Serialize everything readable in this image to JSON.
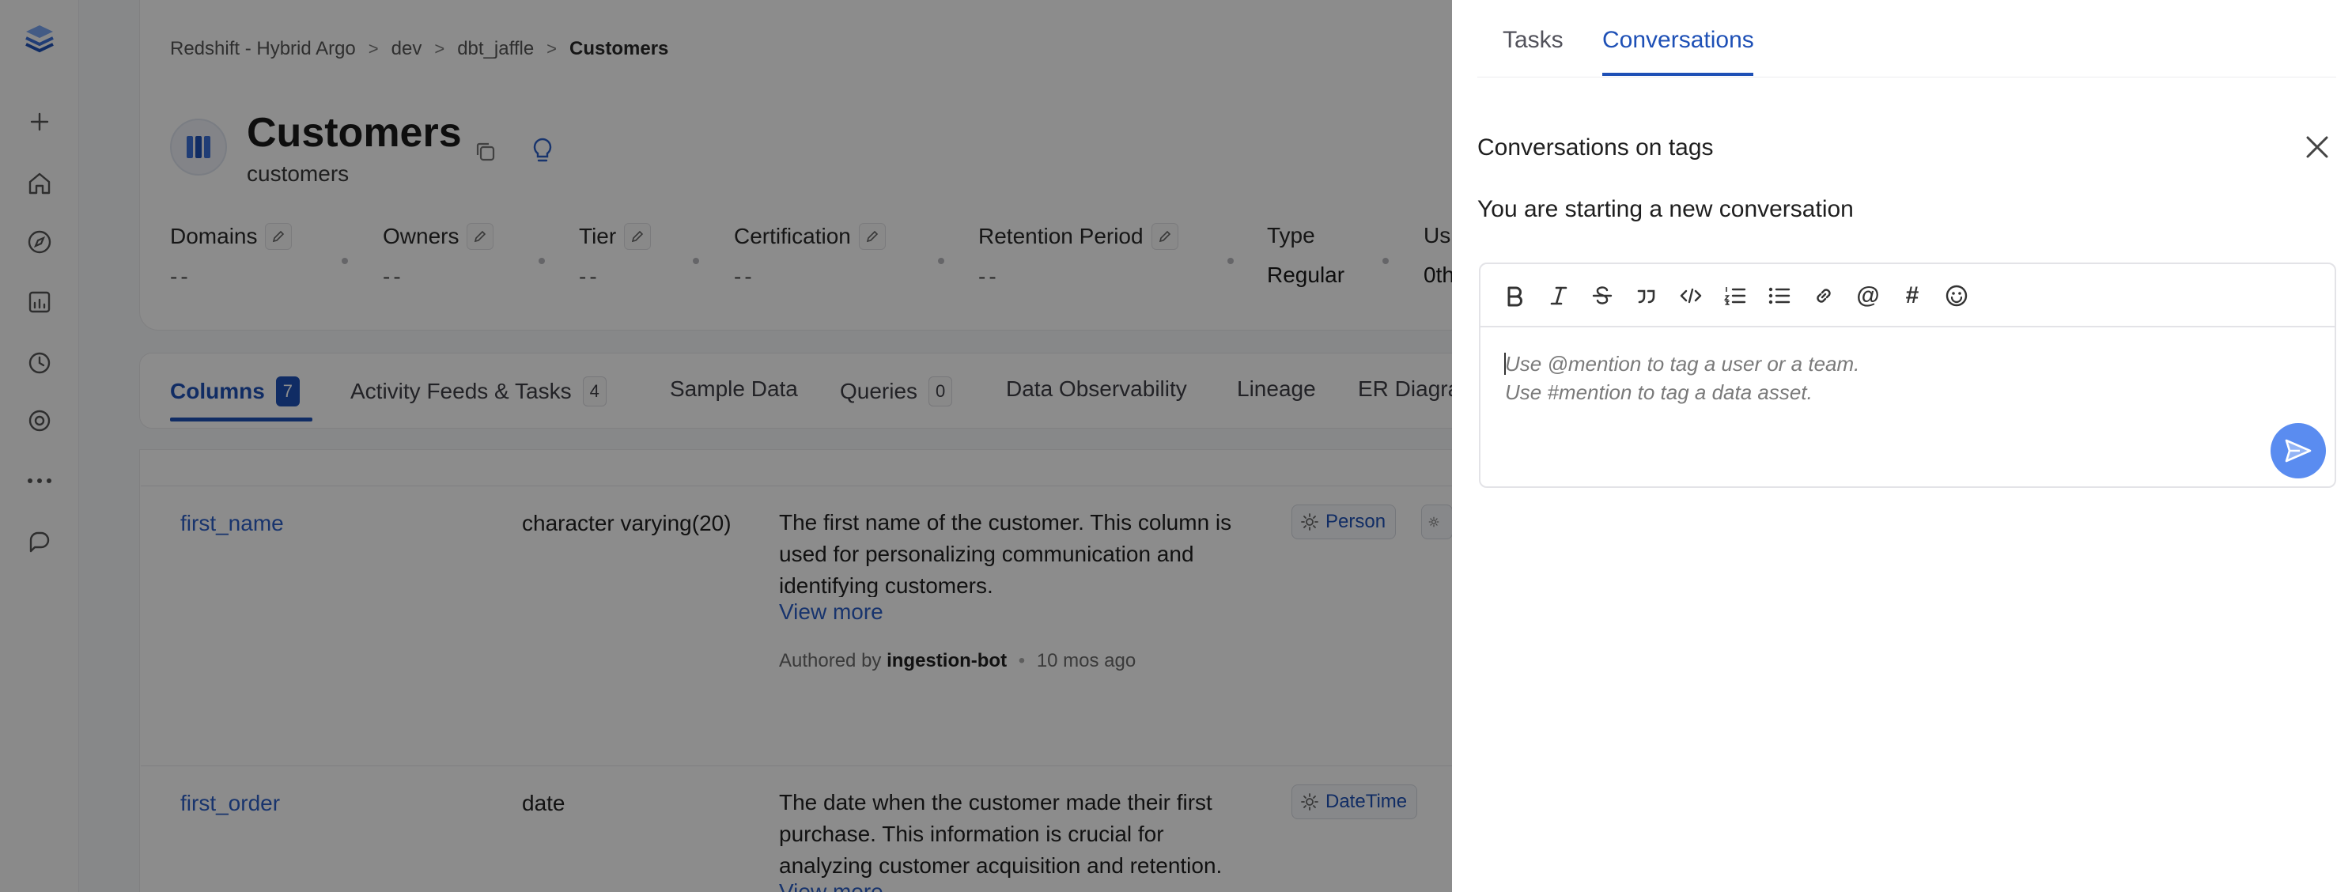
{
  "breadcrumb": {
    "items": [
      "Redshift - Hybrid Argo",
      "dev",
      "dbt_jaffle"
    ],
    "current": "Customers",
    "separator": ">"
  },
  "entity": {
    "title": "Customers",
    "subtitle": "customers",
    "icon": "table-icon"
  },
  "metadata": {
    "domains": {
      "label": "Domains",
      "value": "--"
    },
    "owners": {
      "label": "Owners",
      "value": "--"
    },
    "tier": {
      "label": "Tier",
      "value": "--"
    },
    "certification": {
      "label": "Certification",
      "value": "--"
    },
    "retention": {
      "label": "Retention Period",
      "value": "--"
    },
    "type": {
      "label": "Type",
      "value": "Regular"
    },
    "usage": {
      "label": "Us",
      "value": "0th"
    }
  },
  "tabs": [
    {
      "label": "Columns",
      "count": "7"
    },
    {
      "label": "Activity Feeds & Tasks",
      "count": "4"
    },
    {
      "label": "Sample Data"
    },
    {
      "label": "Queries",
      "count": "0"
    },
    {
      "label": "Data Observability"
    },
    {
      "label": "Lineage"
    },
    {
      "label": "ER Diagra"
    }
  ],
  "rows": [
    {
      "name": "first_name",
      "type": "character varying(20)",
      "description_lines": [
        "The first name of the customer. This column is",
        "used for personalizing communication and",
        "identifying customers."
      ],
      "view_more": "View more",
      "authored_prefix": "Authored by",
      "author": "ingestion-bot",
      "time": "10 mos ago",
      "tag": "Person"
    },
    {
      "name": "first_order",
      "type": "date",
      "description_lines": [
        "The date when the customer made their first",
        "purchase. This information is crucial for",
        "analyzing customer acquisition and retention."
      ],
      "view_more": "View more",
      "tag": "DateTime"
    }
  ],
  "drawer": {
    "tabs": {
      "tasks": "Tasks",
      "conversations": "Conversations"
    },
    "title_prefix": "Conversations on",
    "title_entity": "tags",
    "subtitle": "You are starting a new conversation",
    "placeholder_line1": "Use @mention to tag a user or a team.",
    "placeholder_line2": "Use #mention to tag a data asset.",
    "toolbar": {
      "mention": "@",
      "hashtag": "#"
    }
  },
  "colors": {
    "primary": "#1e50b6",
    "link": "#2c5fc7",
    "send": "#5a8cf0",
    "overlay": "rgba(0,0,0,0.45)"
  }
}
